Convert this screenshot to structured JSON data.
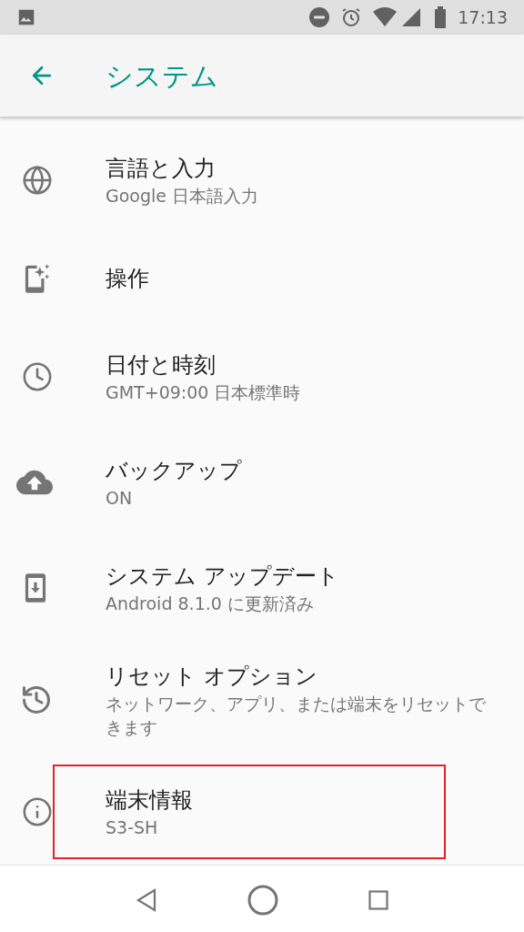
{
  "status_bar": {
    "time": "17:13"
  },
  "toolbar": {
    "title": "システム"
  },
  "items": [
    {
      "title": "言語と入力",
      "subtitle": "Google 日本語入力",
      "highlighted": false
    },
    {
      "title": "操作",
      "highlighted": false
    },
    {
      "title": "日付と時刻",
      "subtitle": "GMT+09:00 日本標準時",
      "highlighted": false
    },
    {
      "title": "バックアップ",
      "subtitle": "ON",
      "highlighted": false
    },
    {
      "title": "システム アップデート",
      "subtitle": "Android 8.1.0 に更新済み",
      "highlighted": false
    },
    {
      "title": "リセット オプション",
      "subtitle": "ネットワーク、アプリ、または端末をリセットできます",
      "highlighted": false
    },
    {
      "title": "端末情報",
      "subtitle": "S3-SH",
      "highlighted": true
    }
  ]
}
